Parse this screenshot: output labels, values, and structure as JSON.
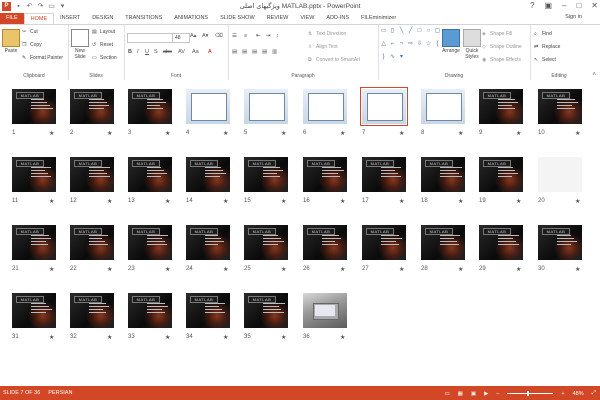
{
  "window": {
    "title": "MATLAB.pptx - PowerPoint",
    "title_prefix": "ویژگیهای اصلی"
  },
  "tabs": [
    "FILE",
    "HOME",
    "INSERT",
    "DESIGN",
    "TRANSITIONS",
    "ANIMATIONS",
    "SLIDE SHOW",
    "REVIEW",
    "VIEW",
    "ADD-INS",
    "FILEminimizer"
  ],
  "active_tab": "HOME",
  "signin": "Sign in",
  "ribbon": {
    "clipboard": {
      "paste": "Paste",
      "cut": "Cut",
      "copy": "Copy",
      "format_painter": "Format Painter",
      "label": "Clipboard"
    },
    "slides": {
      "new_slide": "New Slide",
      "layout": "Layout",
      "reset": "Reset",
      "section": "Section",
      "label": "Slides"
    },
    "font": {
      "font_name": "",
      "font_size": "48",
      "label": "Font",
      "buttons": [
        "B",
        "I",
        "U",
        "S",
        "abc",
        "AV",
        "Aa",
        "A"
      ]
    },
    "paragraph": {
      "text_direction": "Text Direction",
      "align_text": "Align Text",
      "convert": "Convert to SmartArt",
      "label": "Paragraph"
    },
    "drawing": {
      "arrange": "Arrange",
      "quick_styles": "Quick Styles",
      "shape_fill": "Shape Fill",
      "shape_outline": "Shape Outline",
      "shape_effects": "Shape Effects",
      "label": "Drawing"
    },
    "editing": {
      "find": "Find",
      "replace": "Replace",
      "select": "Select",
      "label": "Editing"
    }
  },
  "slides": [
    {
      "n": "1",
      "kind": "matlab"
    },
    {
      "n": "2",
      "kind": "matlab"
    },
    {
      "n": "3",
      "kind": "matlab"
    },
    {
      "n": "4",
      "kind": "shot"
    },
    {
      "n": "5",
      "kind": "shot"
    },
    {
      "n": "6",
      "kind": "shot"
    },
    {
      "n": "7",
      "kind": "shot"
    },
    {
      "n": "8",
      "kind": "shot"
    },
    {
      "n": "9",
      "kind": "matlab"
    },
    {
      "n": "10",
      "kind": "matlab"
    },
    {
      "n": "11",
      "kind": "matlab"
    },
    {
      "n": "12",
      "kind": "matlab"
    },
    {
      "n": "13",
      "kind": "matlab"
    },
    {
      "n": "14",
      "kind": "matlab"
    },
    {
      "n": "15",
      "kind": "matlab"
    },
    {
      "n": "16",
      "kind": "matlab"
    },
    {
      "n": "17",
      "kind": "matlab"
    },
    {
      "n": "18",
      "kind": "matlab"
    },
    {
      "n": "19",
      "kind": "matlab"
    },
    {
      "n": "20",
      "kind": "white"
    },
    {
      "n": "21",
      "kind": "matlab"
    },
    {
      "n": "22",
      "kind": "matlab"
    },
    {
      "n": "23",
      "kind": "matlab"
    },
    {
      "n": "24",
      "kind": "matlab"
    },
    {
      "n": "25",
      "kind": "matlab"
    },
    {
      "n": "26",
      "kind": "matlab"
    },
    {
      "n": "27",
      "kind": "matlab"
    },
    {
      "n": "28",
      "kind": "matlab"
    },
    {
      "n": "29",
      "kind": "matlab"
    },
    {
      "n": "30",
      "kind": "matlab"
    },
    {
      "n": "31",
      "kind": "matlab"
    },
    {
      "n": "32",
      "kind": "matlab"
    },
    {
      "n": "33",
      "kind": "matlab"
    },
    {
      "n": "34",
      "kind": "matlab"
    },
    {
      "n": "35",
      "kind": "matlab"
    },
    {
      "n": "36",
      "kind": "photo"
    }
  ],
  "selected_slide": "7",
  "slide_header": "MATLAB",
  "star": "★",
  "status": {
    "slide": "SLIDE 7 OF 36",
    "language": "PERSIAN",
    "zoom": "48%"
  },
  "colors": {
    "accent": "#d24726"
  }
}
